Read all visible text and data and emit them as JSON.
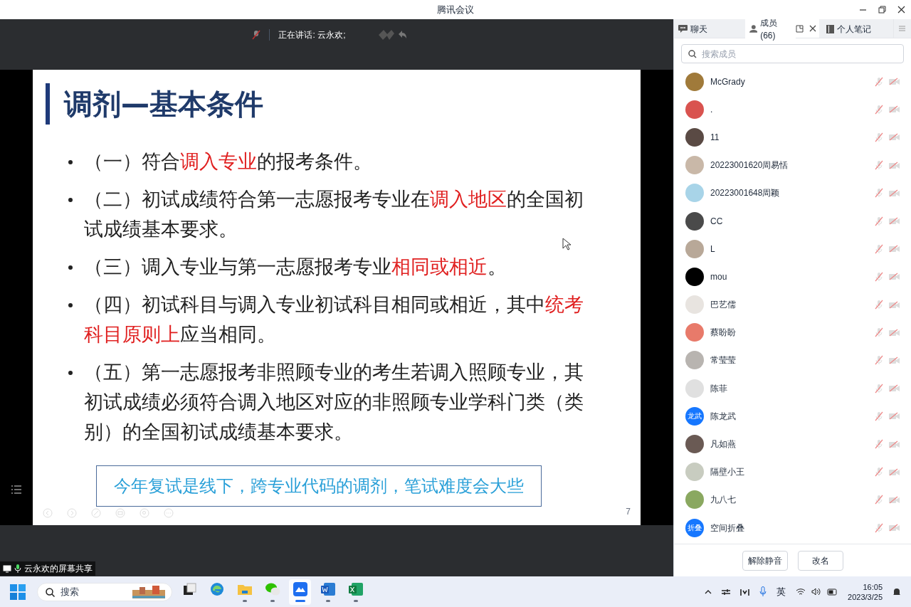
{
  "window": {
    "title": "腾讯会议"
  },
  "speaking_bar": {
    "label": "正在讲话: 云永欢;"
  },
  "slide": {
    "title": "调剂—基本条件",
    "bullets": [
      [
        {
          "text": "（一）符合",
          "highlight": false
        },
        {
          "text": "调入专业",
          "highlight": true
        },
        {
          "text": "的报考条件。",
          "highlight": false
        }
      ],
      [
        {
          "text": "（二）初试成绩符合第一志愿报考专业在",
          "highlight": false
        },
        {
          "text": "调入地区",
          "highlight": true
        },
        {
          "text": "的全国初试成绩基本要求。",
          "highlight": false
        }
      ],
      [
        {
          "text": "（三）调入专业与第一志愿报考专业",
          "highlight": false
        },
        {
          "text": "相同或相近",
          "highlight": true
        },
        {
          "text": "。",
          "highlight": false
        }
      ],
      [
        {
          "text": "（四）初试科目与调入专业初试科目相同或相近，其中",
          "highlight": false
        },
        {
          "text": "统考科目原则上",
          "highlight": true
        },
        {
          "text": "应当相同。",
          "highlight": false
        }
      ],
      [
        {
          "text": "（五）第一志愿报考非照顾专业的考生若调入照顾专业，其初试成绩必须符合调入地区对应的非照顾专业学科门类（类别）的全国初试成绩基本要求。",
          "highlight": false
        }
      ]
    ],
    "note": "今年复试是线下，跨专业代码的调剂，笔试难度会大些",
    "page_number": "7"
  },
  "share_label": "云永欢的屏幕共享",
  "panel": {
    "tabs": [
      {
        "label": "聊天",
        "selected": false
      },
      {
        "label": "成员(66)",
        "selected": true
      },
      {
        "label": "个人笔记",
        "selected": false
      }
    ],
    "search": {
      "placeholder": "搜索成员"
    },
    "members": [
      {
        "name": "McGrady",
        "avatar": {
          "kind": "photo",
          "color": "#a07a3a"
        }
      },
      {
        "name": ".",
        "avatar": {
          "kind": "photo",
          "color": "#d9534f"
        }
      },
      {
        "name": "11",
        "avatar": {
          "kind": "photo",
          "color": "#5a4a44"
        }
      },
      {
        "name": "20223001620周易恬",
        "avatar": {
          "kind": "photo",
          "color": "#c9b8a8"
        }
      },
      {
        "name": "20223001648周颖",
        "avatar": {
          "kind": "photo",
          "color": "#a8d4e8"
        }
      },
      {
        "name": "CC",
        "avatar": {
          "kind": "photo",
          "color": "#4a4a4a"
        }
      },
      {
        "name": "L",
        "avatar": {
          "kind": "photo",
          "color": "#b8a898"
        }
      },
      {
        "name": "mou",
        "avatar": {
          "kind": "photo",
          "color": "#000000"
        }
      },
      {
        "name": "巴艺儒",
        "avatar": {
          "kind": "photo",
          "color": "#e8e4e0"
        }
      },
      {
        "name": "蔡盼盼",
        "avatar": {
          "kind": "photo",
          "color": "#e87a6a"
        }
      },
      {
        "name": "常莹莹",
        "avatar": {
          "kind": "photo",
          "color": "#b8b4b0"
        }
      },
      {
        "name": "陈菲",
        "avatar": {
          "kind": "photo",
          "color": "#e0e0e0"
        }
      },
      {
        "name": "陈龙武",
        "avatar": {
          "kind": "initials",
          "text": "龙武",
          "color": "#1677ff"
        }
      },
      {
        "name": "凡如燕",
        "avatar": {
          "kind": "photo",
          "color": "#6a5a54"
        }
      },
      {
        "name": "隔壁小王",
        "avatar": {
          "kind": "photo",
          "color": "#c8ccc0"
        }
      },
      {
        "name": "九八七",
        "avatar": {
          "kind": "photo",
          "color": "#8aa860"
        }
      },
      {
        "name": "空间折叠",
        "avatar": {
          "kind": "initials",
          "text": "折叠",
          "color": "#1677ff"
        }
      }
    ],
    "buttons": [
      "解除静音",
      "改名"
    ]
  },
  "taskbar": {
    "search": {
      "placeholder": "搜索"
    },
    "apps": [
      {
        "kind": "taskview",
        "running": false,
        "selected": false
      },
      {
        "kind": "edge",
        "running": false,
        "selected": false
      },
      {
        "kind": "folder",
        "running": true,
        "selected": false
      },
      {
        "kind": "wechat",
        "running": true,
        "selected": false
      },
      {
        "kind": "meeting",
        "running": true,
        "selected": true
      },
      {
        "kind": "word",
        "running": true,
        "selected": false
      },
      {
        "kind": "excel",
        "running": true,
        "selected": false
      }
    ],
    "ime": "英",
    "time": "16:05",
    "date": "2023/3/25"
  }
}
